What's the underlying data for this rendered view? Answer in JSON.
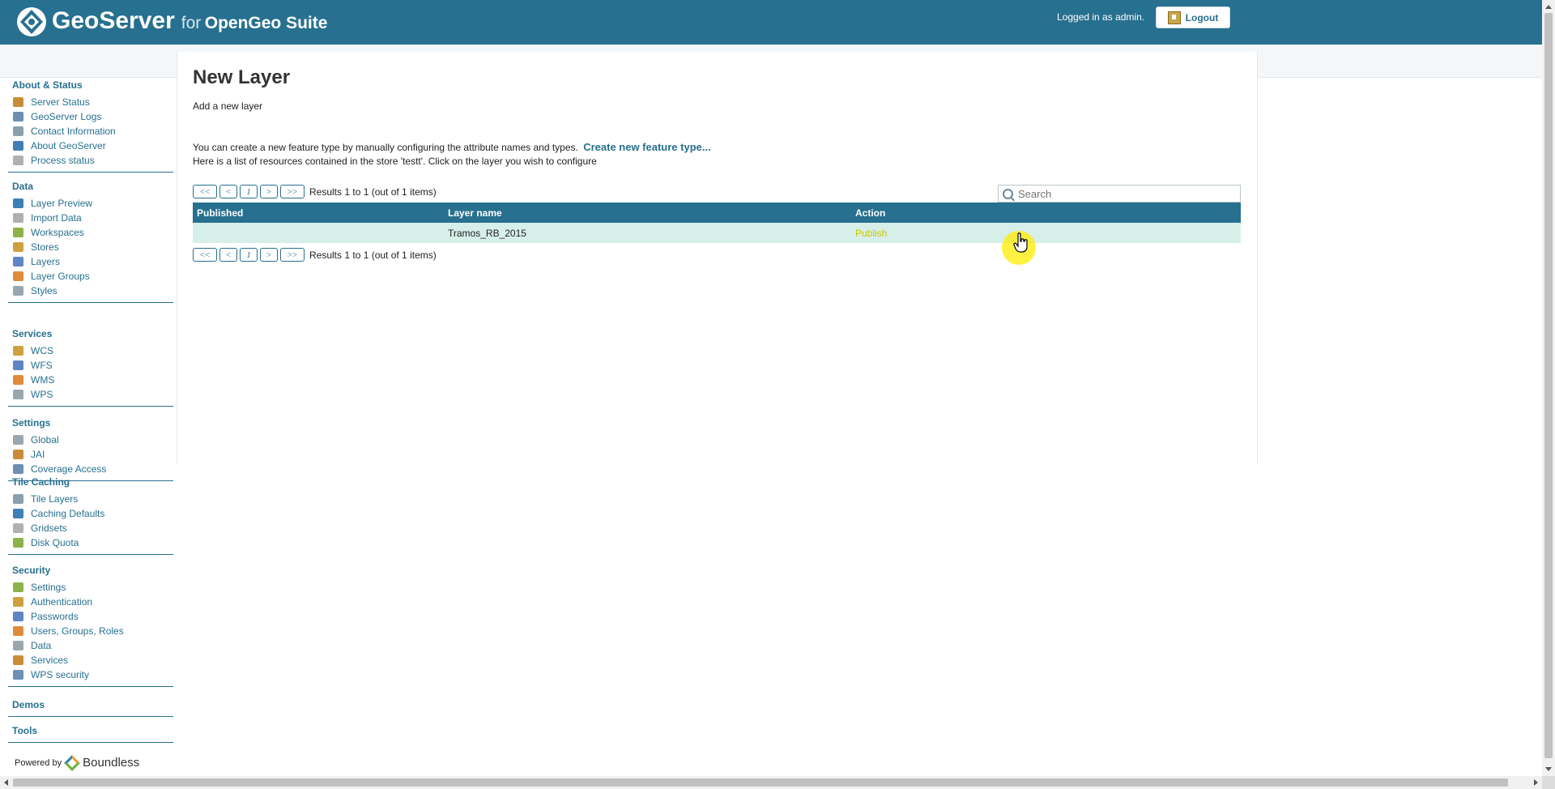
{
  "header": {
    "brand": "GeoServer",
    "brand_for": "for",
    "brand_suite": "OpenGeo Suite",
    "logged_in_text": "Logged in as admin.",
    "logout_label": "Logout"
  },
  "sidebar": {
    "sections": [
      {
        "title": "About & Status",
        "items": [
          "Server Status",
          "GeoServer Logs",
          "Contact Information",
          "About GeoServer",
          "Process status"
        ]
      },
      {
        "title": "Data",
        "items": [
          "Layer Preview",
          "Import Data",
          "Workspaces",
          "Stores",
          "Layers",
          "Layer Groups",
          "Styles"
        ]
      },
      {
        "title": "Services",
        "items": [
          "WCS",
          "WFS",
          "WMS",
          "WPS"
        ]
      },
      {
        "title": "Settings",
        "items": [
          "Global",
          "JAI",
          "Coverage Access"
        ]
      },
      {
        "title": "Tile Caching",
        "items": [
          "Tile Layers",
          "Caching Defaults",
          "Gridsets",
          "Disk Quota"
        ]
      },
      {
        "title": "Security",
        "items": [
          "Settings",
          "Authentication",
          "Passwords",
          "Users, Groups, Roles",
          "Data",
          "Services",
          "WPS security"
        ]
      },
      {
        "title": "Demos",
        "items": []
      },
      {
        "title": "Tools",
        "items": []
      }
    ],
    "powered_by": "Powered by",
    "powered_brand": "Boundless"
  },
  "main": {
    "title": "New Layer",
    "subtitle": "Add a new layer",
    "desc1": "You can create a new feature type by manually configuring the attribute names and types.",
    "create_link": "Create new feature type...",
    "desc2": "Here is a list of resources contained in the store 'testt'. Click on the layer you wish to configure",
    "pager": {
      "first": "<<",
      "prev": "<",
      "page": "1",
      "next": ">",
      "last": ">>",
      "results": "Results 1 to 1 (out of 1 items)"
    },
    "search_placeholder": "Search",
    "table": {
      "headers": [
        "Published",
        "Layer name",
        "Action"
      ],
      "rows": [
        {
          "published": "",
          "layer_name": "Tramos_RB_2015",
          "action": "Publish"
        }
      ]
    }
  }
}
